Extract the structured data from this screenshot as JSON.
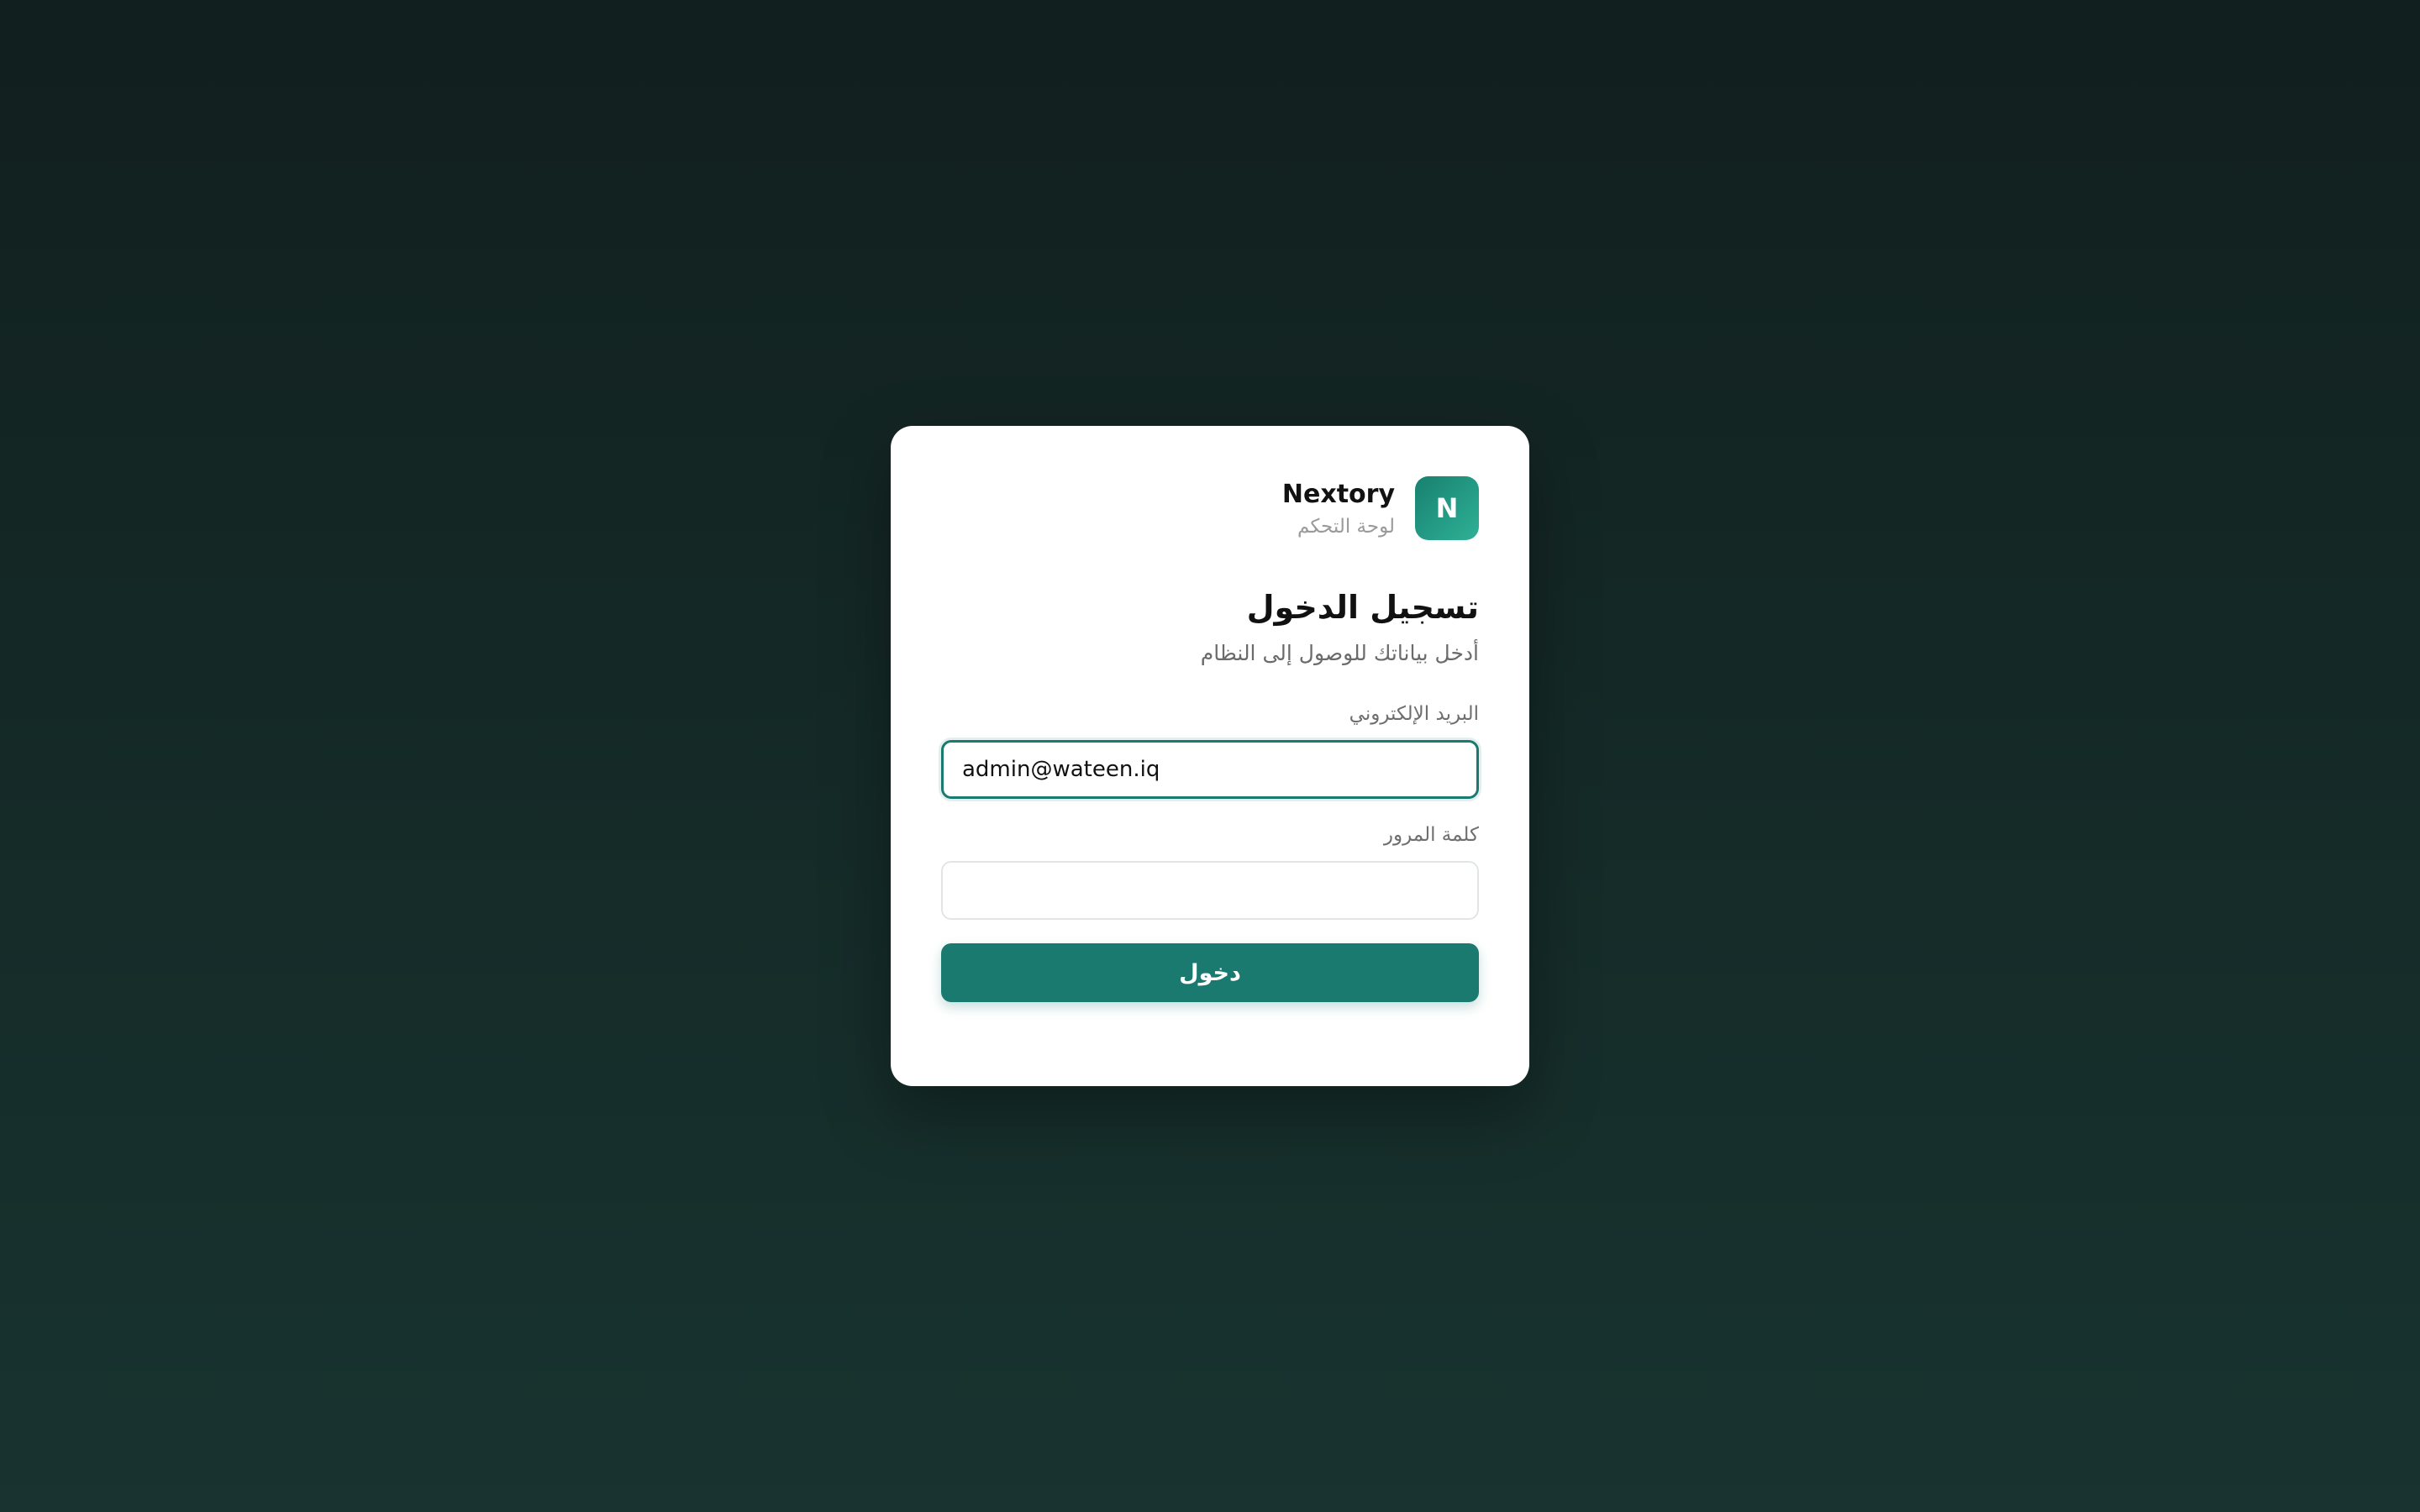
{
  "brand": {
    "logo_letter": "N",
    "name": "Nextory",
    "subtitle": "لوحة التحكم"
  },
  "login": {
    "title": "تسجيل الدخول",
    "subtitle": "أدخل بياناتك للوصول إلى النظام"
  },
  "form": {
    "email_label": "البريد الإلكتروني",
    "email_value": "admin@wateen.iq",
    "password_label": "كلمة المرور",
    "password_value": "",
    "submit_label": "دخول"
  },
  "colors": {
    "accent": "#1b7a70",
    "background": "#132624"
  },
  "icons": {
    "logo": "letter-n-logo-icon"
  }
}
